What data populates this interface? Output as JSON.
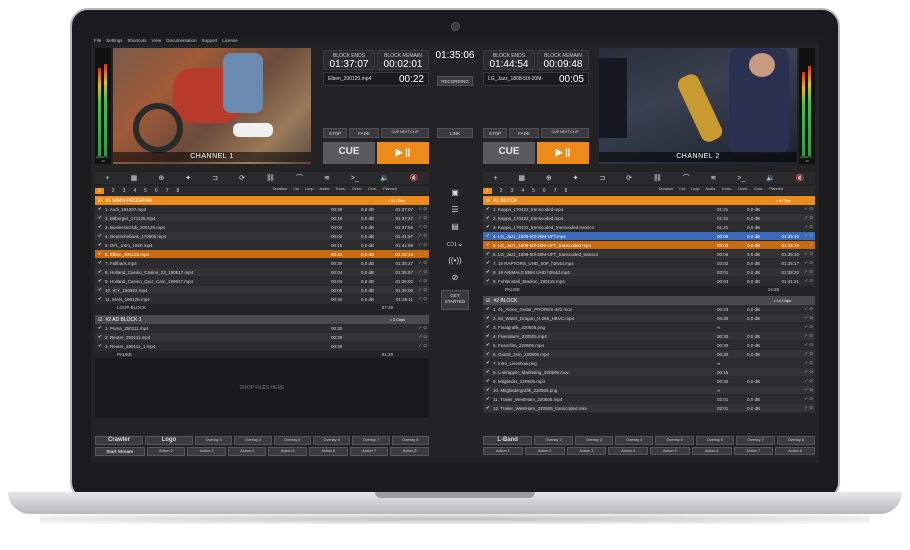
{
  "menu": [
    "File",
    "Settings",
    "Shortcuts",
    "View",
    "Documentation",
    "Support",
    "License"
  ],
  "clock": "01:35:06",
  "left": {
    "channel_label": "CHANNEL 1",
    "meter_label": "AUDIO 0 - 20",
    "block_ends_label": "BLOCK ENDS",
    "block_ends": "01:37:07",
    "block_remain_label": "BLOCK REMAIN",
    "block_remain": "00:02:01",
    "current_file": "Elben_200125.mp4",
    "current_time": "00:22",
    "stop": "STOP",
    "fade": "FADE",
    "cue_next": "CUE NEXT CLIP",
    "cue": "CUE",
    "play": "▶ ||"
  },
  "right": {
    "channel_label": "CHANNEL 2",
    "meter_label": "AUDIO 0 - 20",
    "block_ends_label": "BLOCK ENDS",
    "block_ends": "01:44:54",
    "block_remain_label": "BLOCK REMAIN",
    "block_remain": "00:09:48",
    "current_file": "LG_Jazz_1808-50l-20M-",
    "current_time": "00:05",
    "stop": "STOP",
    "fade": "FADE",
    "cue_next": "CUE NEXT CLIP",
    "cue": "CUE",
    "play": "▶ ||"
  },
  "center": {
    "recording": "RECORDING",
    "link": "LINK",
    "get_started": "GET STARTED",
    "monitor_count": "1"
  },
  "tabs": [
    "1",
    "2",
    "3",
    "4",
    "5",
    "6",
    "7",
    "8"
  ],
  "columns": [
    "Duration",
    "Cut",
    "Loop",
    "Audio",
    "Trans.",
    "Overl.",
    "Com.",
    "Planned"
  ],
  "left_playlist": {
    "group1": {
      "title": "#1  MAIN PROGRAM",
      "count": "• 11 Clips"
    },
    "rows1": [
      {
        "name": "1. Audi_191207.mp4",
        "dur": "00:30",
        "audio": "0,0 dB",
        "planned": "01:37:07"
      },
      {
        "name": "2. Bitburger_171125.mp4",
        "dur": "00:18",
        "audio": "0,0 dB",
        "planned": "01:37:37"
      },
      {
        "name": "3. BusinessClub_200125.mp4",
        "dur": "04:02",
        "audio": "0,0 dB",
        "planned": "01:37:55"
      },
      {
        "name": "4. Deutschebank_170905.mp4",
        "dur": "00:02",
        "audio": "0,0 dB",
        "planned": "01:41:57"
      },
      {
        "name": "5. DFL_Intro_1920.mp4",
        "dur": "00:15",
        "audio": "0,0 dB",
        "planned": "01:41:59"
      },
      {
        "name": "6. Elben_200125.mp4",
        "dur": "00:32",
        "audio": "0,0 dB",
        "planned": "01:42:14"
      },
      {
        "name": "7. Fallback.mp4",
        "dur": "00:30",
        "audio": "0,0 dB",
        "planned": "01:35:27"
      },
      {
        "name": "8. Holland_Casino_Casino_23_190817.mp4",
        "dur": "00:04",
        "audio": "0,0 dB",
        "planned": "01:35:57"
      },
      {
        "name": "9. Holland_Casino_Quiz_Cam_190817.mp4",
        "dur": "00:04",
        "audio": "0,0 dB",
        "planned": "01:36:02"
      },
      {
        "name": "10. ICY_150822.mp4",
        "dur": "00:05",
        "audio": "0,0 dB",
        "planned": "01:36:06"
      },
      {
        "name": "11. MAN_190126.mp4",
        "dur": "00:30",
        "audio": "0,0 dB",
        "planned": "01:36:11"
      }
    ],
    "loop_label": "LOOP BLOCK",
    "loop_time": "07:29",
    "group2": {
      "title": "#2  AD BLOCK 1",
      "count": "• 3 Clips"
    },
    "rows2": [
      {
        "name": "1. Puma_250111.mp4",
        "dur": "00:30",
        "audio": "",
        "planned": ""
      },
      {
        "name": "2. Reuter_250111.mp4",
        "dur": "00:30",
        "audio": "",
        "planned": ""
      },
      {
        "name": "3. Reuter_250111_1.mp4",
        "dur": "00:30",
        "audio": "",
        "planned": ""
      }
    ],
    "pause_label": "PAUSE",
    "pause_time": "01:30",
    "drop_text": "DROP FILES HERE"
  },
  "right_playlist": {
    "group1": {
      "title": "#1  BLOCK",
      "count": "• 9 Clips"
    },
    "rows1": [
      {
        "name": "1. Kappa_170422_transcoded.mp4",
        "dur": "01:31",
        "audio": "0,0 dB",
        "planned": ""
      },
      {
        "name": "2. Kappa_170422_transcoded.mp4",
        "dur": "01:31",
        "audio": "0,0 dB",
        "planned": ""
      },
      {
        "name": "3. Kappa_170422_transcoded_transcoded.transco",
        "dur": "01:31",
        "audio": "0,0 dB",
        "planned": ""
      },
      {
        "name": "4. LG_Jazz_1808-50l-20M-UFT.mp4",
        "dur": "00:06",
        "audio": "0,0 dB",
        "planned": "01:35:10"
      },
      {
        "name": "5. LG_Jazz_1808-50l-20M-UFT_transcoded.mp4",
        "dur": "00:06",
        "audio": "0,0 dB",
        "planned": "01:35:16"
      },
      {
        "name": "6. LG_Jazz_1808-50l-20M-UFT_transcoded_transco",
        "dur": "00:06",
        "audio": "0,0 dB",
        "planned": "01:35:10"
      },
      {
        "name": "7. 15 RAPTORS_UHD_50P_h264d.mp4",
        "dur": "03:02",
        "audio": "0,0 dB",
        "planned": "01:35:17"
      },
      {
        "name": "8. 18 ANIMALS 5994 UHD h264d.mp4",
        "dur": "03:01",
        "audio": "0,0 dB",
        "planned": "01:38:20"
      },
      {
        "name": "9. Fohlenstall_Stadion_190115.mp4",
        "dur": "00:03",
        "audio": "0,0 dB",
        "planned": "01:41:21"
      }
    ],
    "pause_label": "PAUSE",
    "pause_time": "14:29",
    "group2": {
      "title": "#2  BLOCK",
      "count": "• 14 Clips"
    },
    "rows2": [
      {
        "name": "1. 01_Alone_Guitar_PRORES-422.mov",
        "dur": "00:23",
        "audio": "0,0 dB",
        "planned": ""
      },
      {
        "name": "2. 04_Water_Dragon_H.265_HEVC.mp4",
        "dur": "00:30",
        "audio": "0,0 dB",
        "planned": ""
      },
      {
        "name": "3. Finalgrafik_220505.png",
        "dur": "∞",
        "audio": "",
        "planned": ""
      },
      {
        "name": "4. Fiveralarm_220505.mp4",
        "dur": "00:30",
        "audio": "0,0 dB",
        "planned": ""
      },
      {
        "name": "5. Fuserfilm_220505.mp4",
        "dur": "00:30",
        "audio": "0,0 dB",
        "planned": ""
      },
      {
        "name": "6. Grand_Jam_220505.mp4",
        "dur": "00:30",
        "audio": "0,0 dB",
        "planned": ""
      },
      {
        "name": "7. Intro_Liveshow.png",
        "dur": "∞",
        "audio": "",
        "planned": ""
      },
      {
        "name": "8. L-Wrapper_Marketing_220505.mov",
        "dur": "00:15",
        "audio": "",
        "planned": ""
      },
      {
        "name": "9. Mitglieder_220505.mp4",
        "dur": "00:30",
        "audio": "0,0 dB",
        "planned": ""
      },
      {
        "name": "10. Mitgliedergrafik_220505.png",
        "dur": "∞",
        "audio": "",
        "planned": ""
      },
      {
        "name": "11. Trailer_WestHam_220505.mp4",
        "dur": "02:01",
        "audio": "0,0 dB",
        "planned": ""
      },
      {
        "name": "12. Trailer_WestHam_220505_transcoded.mkv",
        "dur": "02:01",
        "audio": "0,0 dB",
        "planned": ""
      }
    ]
  },
  "left_actions": {
    "row1_big": [
      "Crawler",
      "Logo"
    ],
    "row1": [
      "Overlay 3",
      "Overlay 4",
      "Overlay 5",
      "Overlay 6",
      "Overlay 7",
      "Overlay 8"
    ],
    "row2_big": [
      "Start Stream"
    ],
    "row2": [
      "Action 2",
      "Action 3",
      "Action 4",
      "Action 5",
      "Action 6",
      "Action 7",
      "Action 8"
    ]
  },
  "right_actions": {
    "row1_big": [
      "L-Band"
    ],
    "row1": [
      "Overlay 2",
      "Overlay 3",
      "Overlay 4",
      "Overlay 5",
      "Overlay 6",
      "Overlay 7",
      "Overlay 8"
    ],
    "row2": [
      "Action 1",
      "Action 2",
      "Action 3",
      "Action 4",
      "Action 5",
      "Action 6",
      "Action 7",
      "Action 8"
    ]
  },
  "colors": {
    "accent": "#ec8a1a",
    "selected_blue": "#3a6ab8",
    "background": "#232326"
  }
}
